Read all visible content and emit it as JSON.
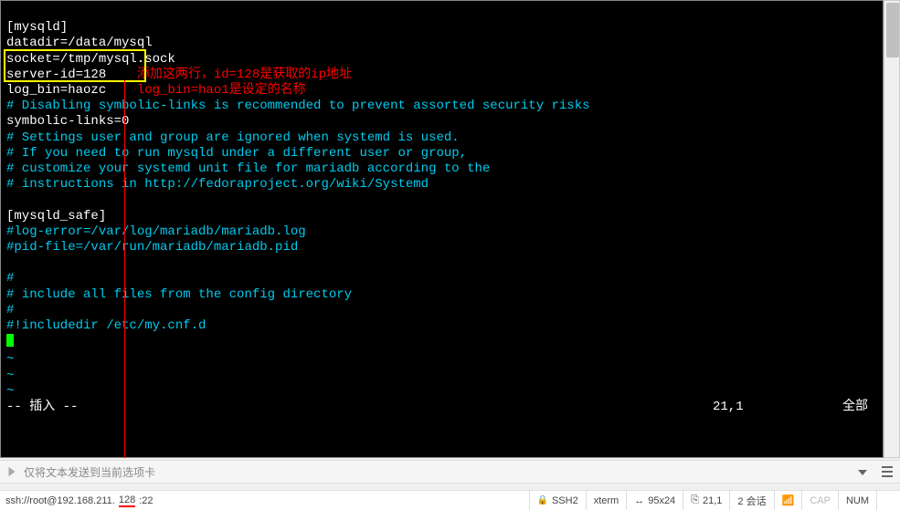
{
  "terminal": {
    "lines": {
      "l1": "[mysqld]",
      "l2": "datadir=/data/mysql",
      "l3": "socket=/tmp/mysql.sock",
      "l4a": "server-id=128",
      "l4b": "    添加这两行，id=128是获取的ip地址",
      "l5a": "log_bin=haozc",
      "l5b": "    log_bin=hao1是设定的名称",
      "l6": "# Disabling symbolic-links is recommended to prevent assorted security risks",
      "l7": "symbolic-links=0",
      "l8": "# Settings user and group are ignored when systemd is used.",
      "l9": "# If you need to run mysqld under a different user or group,",
      "l10": "# customize your systemd unit file for mariadb according to the",
      "l11": "# instructions in http://fedoraproject.org/wiki/Systemd",
      "l12": "",
      "l13": "[mysqld_safe]",
      "l14": "#log-error=/var/log/mariadb/mariadb.log",
      "l15": "#pid-file=/var/run/mariadb/mariadb.pid",
      "l16": "",
      "l17": "#",
      "l18": "# include all files from the config directory",
      "l19": "#",
      "l20": "#!includedir /etc/my.cnf.d",
      "tilde": "~"
    },
    "vim_mode": "-- 插入 --",
    "vim_pos": "21,1",
    "vim_right": "全部"
  },
  "input_bar": {
    "placeholder": "仅将文本发送到当前选项卡"
  },
  "status": {
    "conn_pre": "ssh://root@192.168.211.",
    "conn_hl": "128",
    "conn_post": ":22",
    "ssh2": "SSH2",
    "term": "xterm",
    "size": "95x24",
    "pos": "21,1",
    "sessions": "2 会话",
    "cap": "CAP",
    "num": "NUM"
  }
}
